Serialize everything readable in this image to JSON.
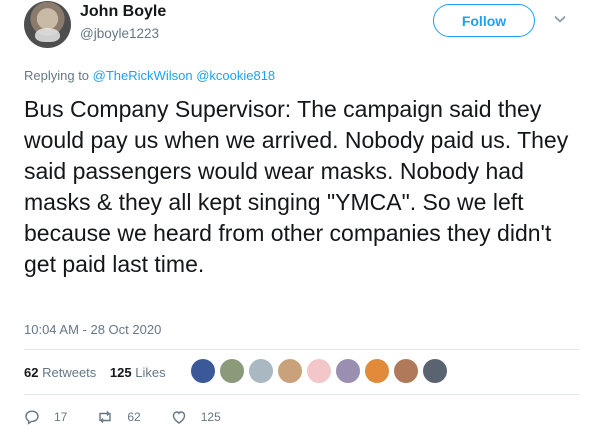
{
  "user": {
    "name": "John Boyle",
    "handle": "@jboyle1223"
  },
  "follow_label": "Follow",
  "replying": {
    "prefix": "Replying to",
    "mention1": "@TheRickWilson",
    "mention2": "@kcookie818"
  },
  "tweet_text": "Bus Company Supervisor: The campaign said they would pay us when we arrived. Nobody paid us. They said passengers would wear masks. Nobody had masks & they all kept singing \"YMCA\". So we left because we heard from other companies they didn't get paid last time.",
  "timestamp": "10:04 AM - 28 Oct 2020",
  "stats": {
    "retweets_count": "62",
    "retweets_label": "Retweets",
    "likes_count": "125",
    "likes_label": "Likes"
  },
  "liker_colors": [
    "#3b5998",
    "#8a9a7a",
    "#aab8c2",
    "#c9a27b",
    "#f3c6c9",
    "#9a8fb0",
    "#e08a3a",
    "#b07a5a",
    "#5a6470"
  ],
  "actions": {
    "reply_count": "17",
    "retweet_count": "62",
    "like_count": "125"
  }
}
